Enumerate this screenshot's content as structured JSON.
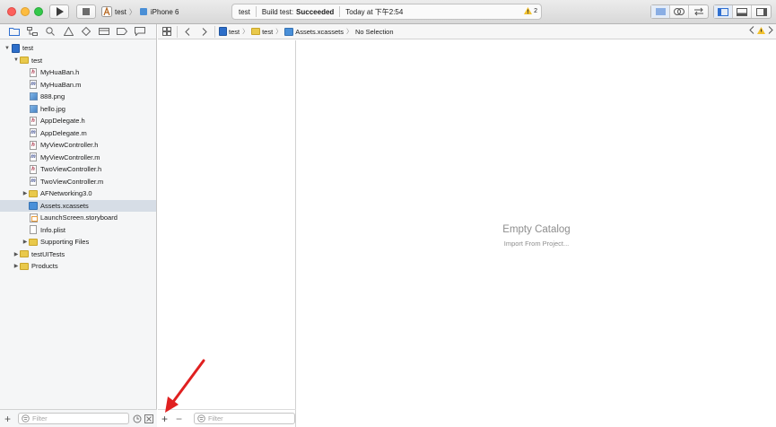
{
  "window": {
    "scheme_name": "test",
    "device": "iPhone 6",
    "status_project": "test",
    "status_label": "Build test:",
    "status_result": "Succeeded",
    "status_time": "Today at 下午2:54",
    "warning_count": "2"
  },
  "navigator": {
    "items": [
      {
        "label": "test",
        "kind": "project"
      },
      {
        "label": "test",
        "kind": "folder"
      },
      {
        "label": "MyHuaBan.h",
        "kind": "h"
      },
      {
        "label": "MyHuaBan.m",
        "kind": "m"
      },
      {
        "label": "888.png",
        "kind": "image"
      },
      {
        "label": "hello.jpg",
        "kind": "image"
      },
      {
        "label": "AppDelegate.h",
        "kind": "h"
      },
      {
        "label": "AppDelegate.m",
        "kind": "m"
      },
      {
        "label": "MyViewController.h",
        "kind": "h"
      },
      {
        "label": "MyViewController.m",
        "kind": "m"
      },
      {
        "label": "TwoViewController.h",
        "kind": "h"
      },
      {
        "label": "TwoViewController.m",
        "kind": "m"
      },
      {
        "label": "AFNetworking3.0",
        "kind": "folder"
      },
      {
        "label": "Assets.xcassets",
        "kind": "xcassets"
      },
      {
        "label": "LaunchScreen.storyboard",
        "kind": "storyboard"
      },
      {
        "label": "Info.plist",
        "kind": "plist"
      },
      {
        "label": "Supporting Files",
        "kind": "folder"
      },
      {
        "label": "testUITests",
        "kind": "folder"
      },
      {
        "label": "Products",
        "kind": "folder"
      }
    ],
    "filter_placeholder": "Filter"
  },
  "jumpbar": {
    "crumb_project": "test",
    "crumb_group": "test",
    "crumb_file": "Assets.xcassets",
    "crumb_selection": "No Selection"
  },
  "assetlist": {
    "filter_placeholder": "Filter",
    "add_label": "+",
    "remove_label": "−"
  },
  "catalog": {
    "empty_title": "Empty Catalog",
    "import_link": "Import From Project..."
  },
  "colors": {
    "selection": "#d6dde6",
    "annotation_arrow": "#e02020",
    "folder": "#e9c94b"
  }
}
